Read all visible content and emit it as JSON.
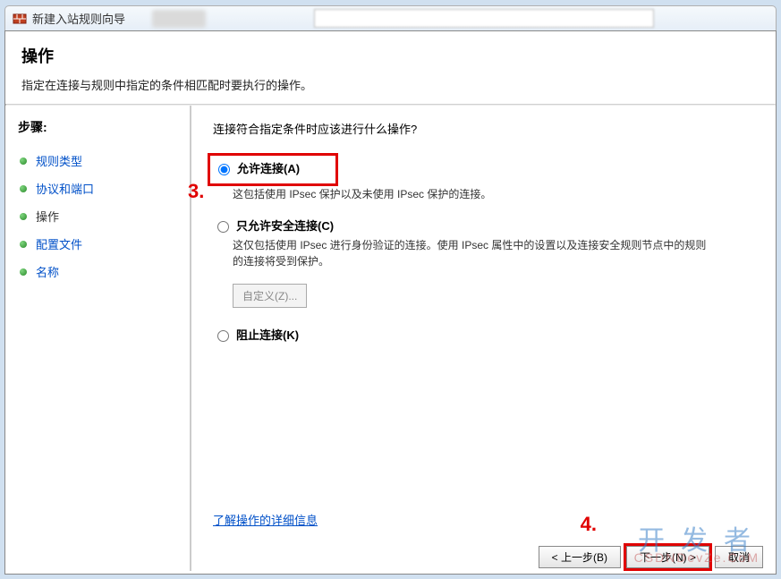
{
  "window": {
    "title": "新建入站规则向导"
  },
  "header": {
    "title": "操作",
    "subtitle": "指定在连接与规则中指定的条件相匹配时要执行的操作。"
  },
  "sidebar": {
    "steps_label": "步骤:",
    "items": [
      {
        "label": "规则类型",
        "active": false
      },
      {
        "label": "协议和端口",
        "active": false
      },
      {
        "label": "操作",
        "active": true
      },
      {
        "label": "配置文件",
        "active": false
      },
      {
        "label": "名称",
        "active": false
      }
    ]
  },
  "content": {
    "prompt": "连接符合指定条件时应该进行什么操作?",
    "options": {
      "allow": {
        "label": "允许连接(A)",
        "desc": "这包括使用 IPsec 保护以及未使用 IPsec 保护的连接。"
      },
      "secure": {
        "label": "只允许安全连接(C)",
        "desc": "这仅包括使用 IPsec 进行身份验证的连接。使用 IPsec 属性中的设置以及连接安全规则节点中的规则的连接将受到保护。"
      },
      "block": {
        "label": "阻止连接(K)"
      }
    },
    "custom_btn": "自定义(Z)...",
    "learn_more": "了解操作的详细信息"
  },
  "buttons": {
    "back": "< 上一步(B)",
    "next": "下一步(N) >",
    "cancel": "取消"
  },
  "annotations": {
    "three": "3.",
    "four": "4."
  },
  "watermark": {
    "main": "开发者",
    "sub": "CSDNDevZe.CoM"
  }
}
